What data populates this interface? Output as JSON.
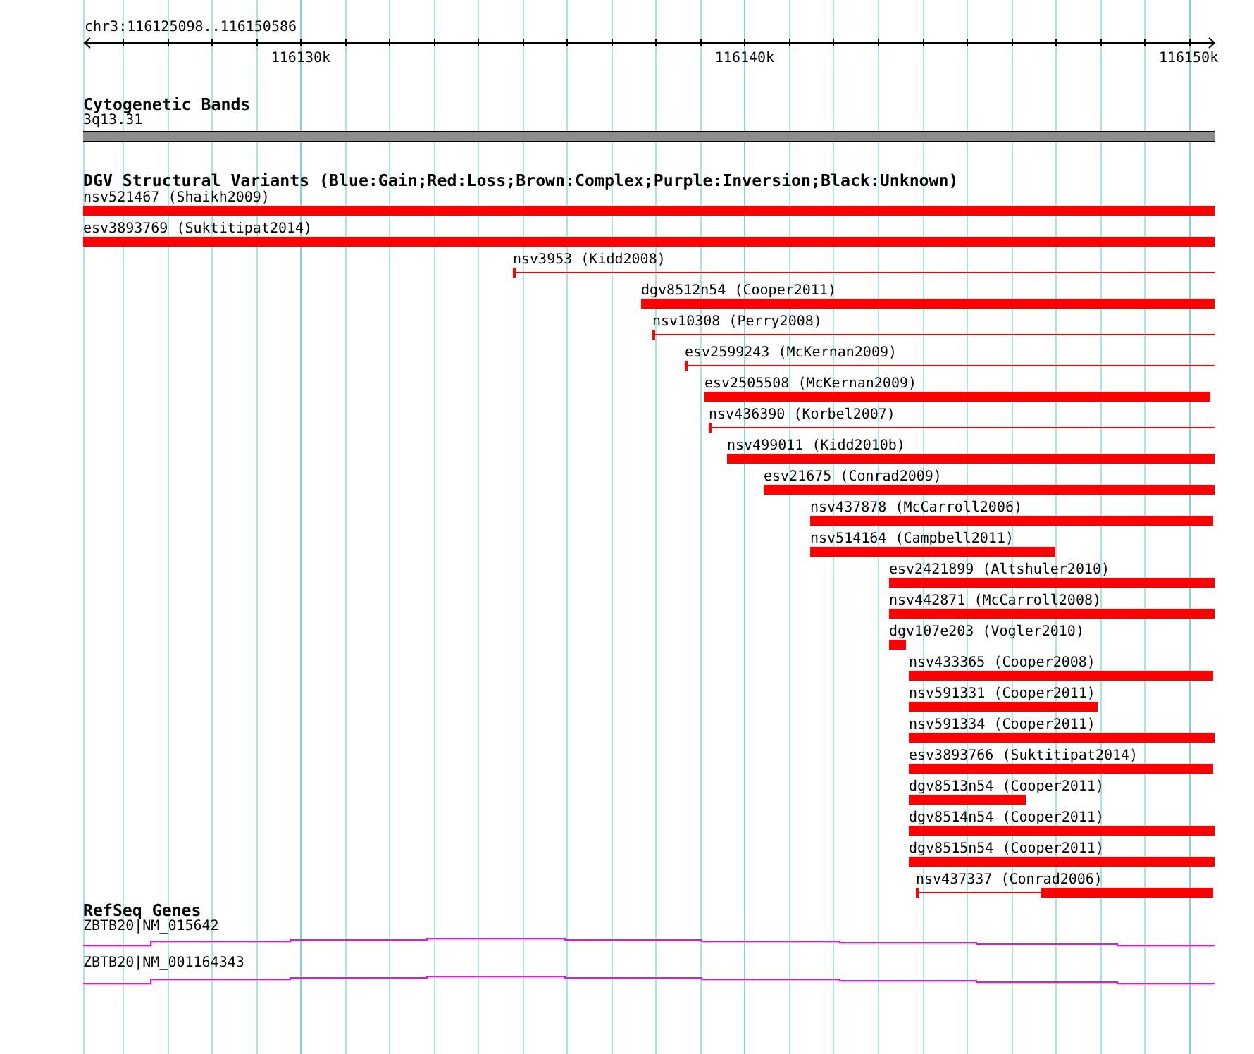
{
  "ruler": {
    "location": "chr3:116125098..116150586",
    "ticks": [
      "116130k",
      "116140k",
      "116150k"
    ]
  },
  "tracks": [
    {
      "kind": "cytoband",
      "title": "Cytogenetic Bands",
      "features": [
        {
          "label": "3q13.31"
        }
      ]
    },
    {
      "kind": "variants",
      "title": "DGV Structural Variants (Blue:Gain;Red:Loss;Brown:Complex;Purple:Inversion;Black:Unknown)",
      "features": [
        {
          "label": "nsv521467 (Shaikh2009)",
          "kind": "block",
          "color": "#ff0000"
        },
        {
          "label": "esv3893769 (Suktitipat2014)",
          "kind": "block",
          "color": "#ff0000"
        },
        {
          "label": "nsv3953 (Kidd2008)",
          "kind": "span",
          "color": "#ff0000"
        },
        {
          "label": "dgv8512n54 (Cooper2011)",
          "kind": "block",
          "color": "#ff0000"
        },
        {
          "label": "nsv10308 (Perry2008)",
          "kind": "span",
          "color": "#ff0000"
        },
        {
          "label": "esv2599243 (McKernan2009)",
          "kind": "span",
          "color": "#ff0000"
        },
        {
          "label": "esv2505508 (McKernan2009)",
          "kind": "block",
          "color": "#ff0000"
        },
        {
          "label": "nsv436390 (Korbel2007)",
          "kind": "span",
          "color": "#ff0000"
        },
        {
          "label": "nsv499011 (Kidd2010b)",
          "kind": "block",
          "color": "#ff0000"
        },
        {
          "label": "esv21675 (Conrad2009)",
          "kind": "block",
          "color": "#ff0000"
        },
        {
          "label": "nsv437878 (McCarroll2006)",
          "kind": "block",
          "color": "#ff0000"
        },
        {
          "label": "nsv514164 (Campbell2011)",
          "kind": "block",
          "color": "#ff0000"
        },
        {
          "label": "esv2421899 (Altshuler2010)",
          "kind": "block",
          "color": "#ff0000"
        },
        {
          "label": "nsv442871 (McCarroll2008)",
          "kind": "block",
          "color": "#ff0000"
        },
        {
          "label": "dgv107e203 (Vogler2010)",
          "kind": "block",
          "color": "#ff0000"
        },
        {
          "label": "nsv433365 (Cooper2008)",
          "kind": "block",
          "color": "#ff0000"
        },
        {
          "label": "nsv591331 (Cooper2011)",
          "kind": "block",
          "color": "#ff0000"
        },
        {
          "label": "nsv591334 (Cooper2011)",
          "kind": "block",
          "color": "#ff0000"
        },
        {
          "label": "esv3893766 (Suktitipat2014)",
          "kind": "block",
          "color": "#ff0000"
        },
        {
          "label": "dgv8513n54 (Cooper2011)",
          "kind": "block",
          "color": "#ff0000"
        },
        {
          "label": "dgv8514n54 (Cooper2011)",
          "kind": "block",
          "color": "#ff0000"
        },
        {
          "label": "dgv8515n54 (Cooper2011)",
          "kind": "block",
          "color": "#ff0000"
        },
        {
          "label": "nsv437337 (Conrad2006)",
          "kind": "partial",
          "color": "#ff0000"
        }
      ]
    },
    {
      "kind": "genes",
      "title": "RefSeq Genes",
      "features": [
        {
          "label": "ZBTB20|NM_015642"
        },
        {
          "label": "ZBTB20|NM_001164343"
        }
      ]
    }
  ]
}
